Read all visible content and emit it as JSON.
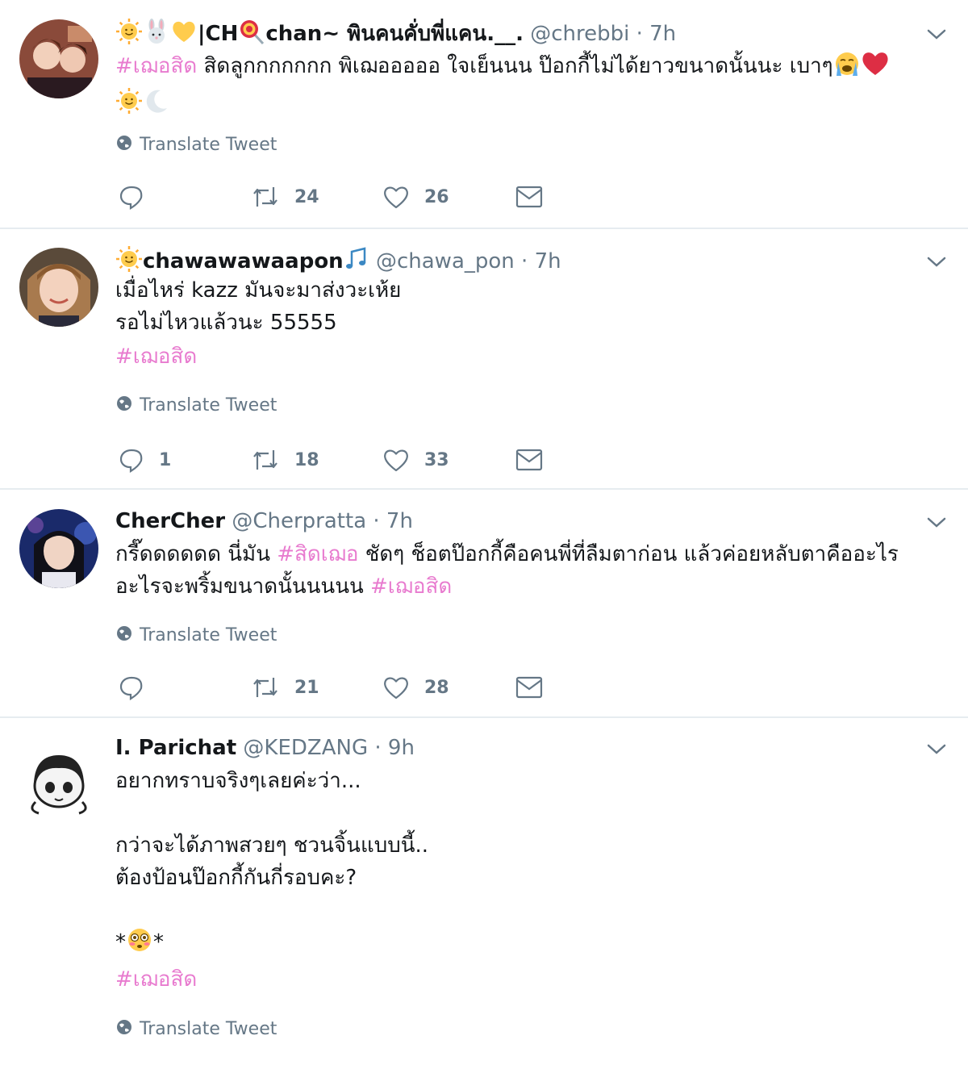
{
  "tweets": [
    {
      "name": "|CH chan~ พินคนคั่บพี่แคน.__.",
      "handle": "@chrebbi",
      "time": "7h",
      "hashtag_start": "#เฌอสิด",
      "text_line1": " สิดลูกกกกกกก พิเฌอออออ ใจเย็นนน ป๊อกกี้ไม่ได้ยาวขนาดนั้นนะ เบาๆ",
      "translate": "Translate Tweet",
      "retweets": "24",
      "likes": "26",
      "emoji_prefix": [
        "sun-emoji",
        "rabbit-emoji",
        "yellow-heart-emoji"
      ],
      "emoji_inline": [
        "lollipop-emoji"
      ],
      "emoji_suffix": [
        "crying-face-emoji",
        "red-heart-emoji"
      ],
      "emoji_line2": [
        "sun-emoji",
        "moon-emoji"
      ]
    },
    {
      "name": "chawawawaapon",
      "handle": "@chawa_pon",
      "time": "7h",
      "line1": "เมื่อไหร่ kazz มันจะมาส่งวะเห้ย",
      "line2": "รอไม่ไหวแล้วนะ 55555",
      "hashtag": "#เฌอสิด",
      "translate": "Translate Tweet",
      "replies": "1",
      "retweets": "18",
      "likes": "33",
      "emoji_prefix": [
        "sun-emoji"
      ],
      "emoji_suffix": [
        "music-emoji"
      ]
    },
    {
      "name": "CherCher",
      "handle": "@Cherpratta",
      "time": "7h",
      "line1_a": "กรี๊ดดดดดด นี่มัน ",
      "line1_tag": "#สิดเฌอ",
      "line1_b": " ชัดๆ ช็อตป๊อกกี้คือคนพี่ที่ลืมตาก่อน แล้วค่อยหลับตาคืออะไร",
      "line2_a": "อะไรจะพริ้มขนาดนั้นนนนน ",
      "line2_tag": "#เฌอสิด",
      "translate": "Translate Tweet",
      "retweets": "21",
      "likes": "28"
    },
    {
      "name": "I. Parichat",
      "handle": "@KEDZANG",
      "time": "9h",
      "line1": "อยากทราบจริงๆเลยค่ะว่า...",
      "line2": "กว่าจะได้ภาพสวยๆ ชวนจิ้นแบบนี้..",
      "line3": "ต้องป้อนป๊อกกี้กันกี่รอบคะ?",
      "line4_deco": "*",
      "hashtag": "#เฌอสิด",
      "translate": "Translate Tweet",
      "emoji_line4": [
        "flushed-face-emoji"
      ]
    }
  ],
  "colors": {
    "hashtag": "#e87bcf",
    "muted": "#657786",
    "divider": "#e6ecf0"
  }
}
